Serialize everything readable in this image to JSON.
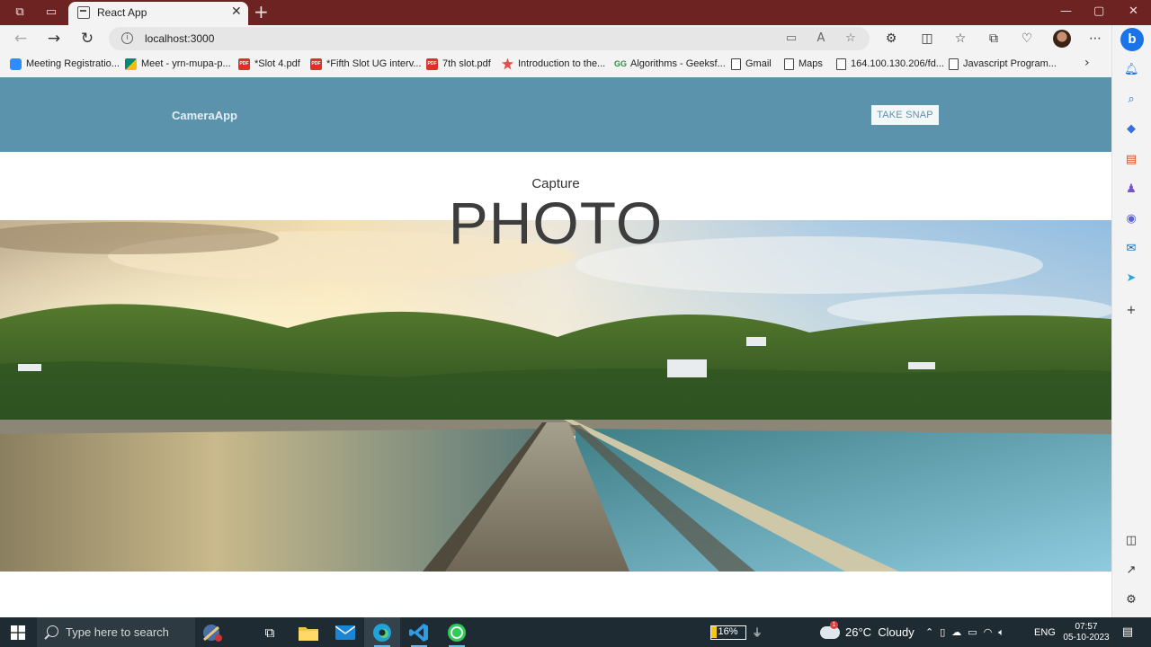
{
  "browser": {
    "tab_title": "React App",
    "url": "localhost:3000",
    "bookmarks": [
      {
        "label": "Meeting Registratio...",
        "icon": "zoom-icon",
        "color": "#2d8cff"
      },
      {
        "label": "Meet - yrn-mupa-p...",
        "icon": "meet-icon",
        "color": "#00897b"
      },
      {
        "label": "*Slot 4.pdf",
        "icon": "pdf-icon",
        "color": "#d7332c"
      },
      {
        "label": "*Fifth Slot UG interv...",
        "icon": "pdf-icon",
        "color": "#d7332c"
      },
      {
        "label": "7th slot.pdf",
        "icon": "pdf-icon",
        "color": "#d7332c"
      },
      {
        "label": "Introduction to the...",
        "icon": "star-badge-icon",
        "color": "#e0514a"
      },
      {
        "label": "Algorithms - Geeksf...",
        "icon": "gfg-icon",
        "color": "#2f8d46"
      },
      {
        "label": "Gmail",
        "icon": "page-icon",
        "color": "#444444"
      },
      {
        "label": "Maps",
        "icon": "page-icon",
        "color": "#444444"
      },
      {
        "label": "164.100.130.206/fd...",
        "icon": "page-icon",
        "color": "#444444"
      },
      {
        "label": "Javascript Program...",
        "icon": "page-icon",
        "color": "#444444"
      }
    ]
  },
  "app": {
    "brand": "CameraApp",
    "snap_button": "TAKE SNAP",
    "subtitle": "Capture",
    "title": "PHOTO"
  },
  "colors": {
    "navbar": "#5b93ad",
    "titlebar": "#6e2323",
    "taskbar": "#1f2b33"
  },
  "taskbar": {
    "search_placeholder": "Type here to search",
    "battery": "16%",
    "weather": "26°C  Cloudy",
    "language": "ENG",
    "time": "07:57",
    "date": "05-10-2023",
    "weather_badge": "1"
  }
}
